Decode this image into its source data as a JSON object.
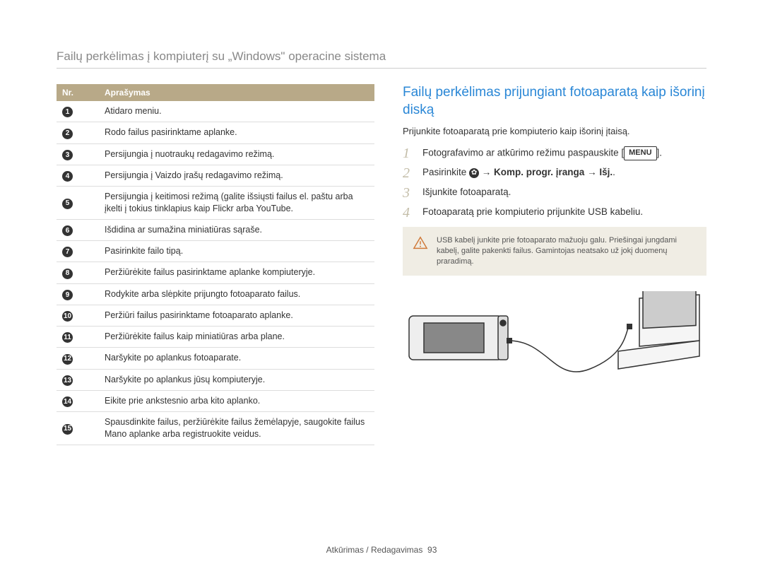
{
  "page_title": "Failų perkėlimas į kompiuterį su „Windows\" operacine sistema",
  "table": {
    "headers": {
      "nr": "Nr.",
      "desc": "Aprašymas"
    },
    "rows": [
      {
        "n": "1",
        "desc": "Atidaro meniu."
      },
      {
        "n": "2",
        "desc": "Rodo failus pasirinktame aplanke."
      },
      {
        "n": "3",
        "desc": "Persijungia į nuotraukų redagavimo režimą."
      },
      {
        "n": "4",
        "desc": "Persijungia į Vaizdo įrašų redagavimo režimą."
      },
      {
        "n": "5",
        "desc": "Persijungia į keitimosi režimą (galite išsiųsti failus el. paštu arba įkelti į tokius tinklapius kaip Flickr arba YouTube."
      },
      {
        "n": "6",
        "desc": "Išdidina ar sumažina miniatiūras sąraše."
      },
      {
        "n": "7",
        "desc": "Pasirinkite failo tipą."
      },
      {
        "n": "8",
        "desc": "Peržiūrėkite failus pasirinktame aplanke kompiuteryje."
      },
      {
        "n": "9",
        "desc": "Rodykite arba slėpkite prijungto fotoaparato failus."
      },
      {
        "n": "10",
        "desc": "Peržiūri failus pasirinktame fotoaparato aplanke."
      },
      {
        "n": "11",
        "desc": "Peržiūrėkite failus kaip miniatiūras arba plane."
      },
      {
        "n": "12",
        "desc": "Naršykite po aplankus fotoaparate."
      },
      {
        "n": "13",
        "desc": "Naršykite po aplankus jūsų kompiuteryje."
      },
      {
        "n": "14",
        "desc": "Eikite prie ankstesnio arba kito aplanko."
      },
      {
        "n": "15",
        "desc": "Spausdinkite failus, peržiūrėkite failus žemėlapyje, saugokite failus Mano aplanke arba registruokite veidus."
      }
    ]
  },
  "right": {
    "title": "Failų perkėlimas prijungiant fotoaparatą kaip išorinį diską",
    "intro": "Prijunkite fotoaparatą prie kompiuterio kaip išorinį įtaisą.",
    "steps": {
      "s1_a": "Fotografavimo ar atkūrimo režimu paspauskite [",
      "s1_menu": "MENU",
      "s1_b": "].",
      "s2_a": "Pasirinkite ",
      "s2_mid": " → ",
      "s2_opt": "Komp. progr. įranga",
      "s2_mid2": " → ",
      "s2_off": "Išj.",
      "s2_end": ".",
      "s3": "Išjunkite fotoaparatą.",
      "s4": "Fotoaparatą prie kompiuterio prijunkite USB kabeliu."
    },
    "warning": "USB kabelį junkite prie fotoaparato mažuoju galu. Priešingai jungdami kabelį, galite pakenkti failus. Gamintojas neatsako už jokį duomenų praradimą."
  },
  "footer": {
    "label": "Atkūrimas / Redagavimas",
    "page": "93"
  }
}
